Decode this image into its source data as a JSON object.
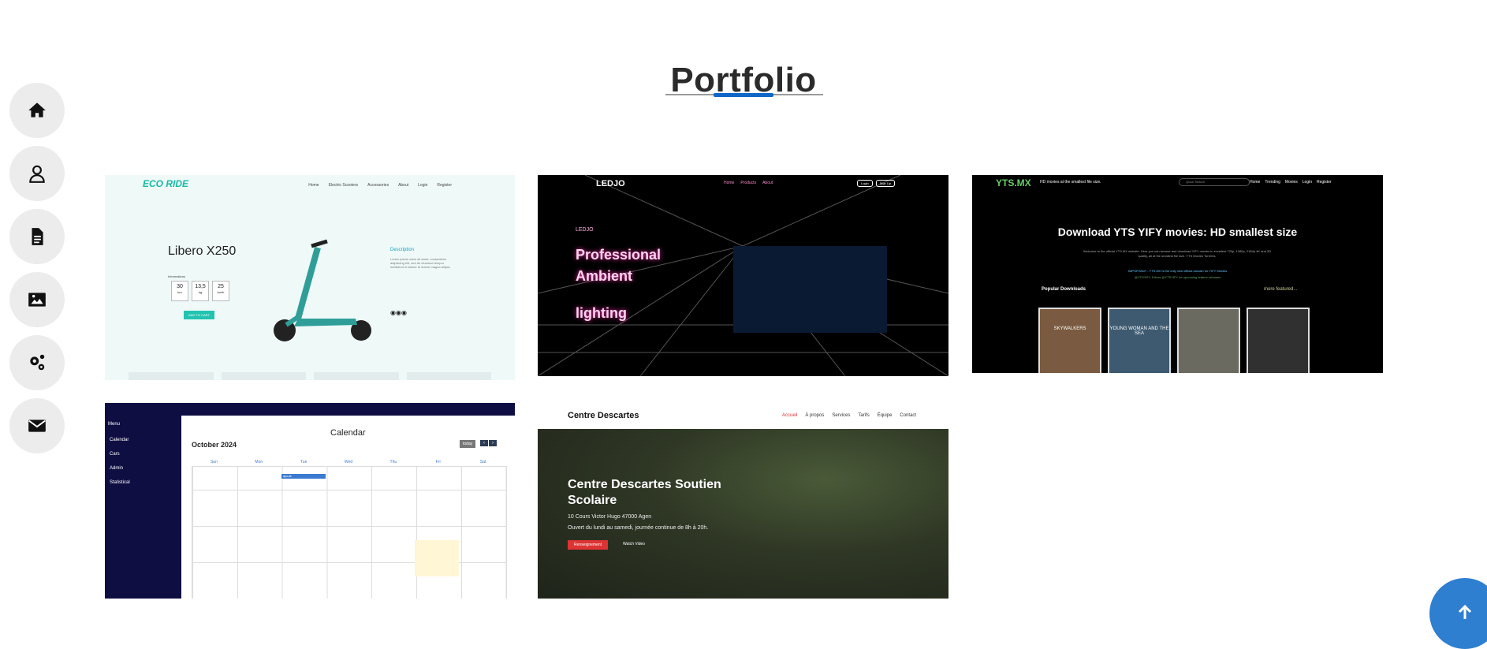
{
  "page": {
    "title": "Portfolio"
  },
  "sidebar": {
    "items": [
      {
        "icon": "home-icon"
      },
      {
        "icon": "user-icon"
      },
      {
        "icon": "document-icon"
      },
      {
        "icon": "image-icon"
      },
      {
        "icon": "gears-icon"
      },
      {
        "icon": "envelope-icon"
      }
    ]
  },
  "colors": {
    "accent": "#1167c8",
    "scroll_button": "#2f7fd0",
    "sidebar_bg": "#ececec"
  },
  "projects": {
    "ecoride": {
      "logo": "ECO RIDE",
      "nav": [
        "Home",
        "Electric Scooters",
        "Accessories",
        "About",
        "Login",
        "Register"
      ],
      "product": "Libero X250",
      "info_label": "Informations",
      "stats": [
        {
          "value": "30",
          "unit": "km"
        },
        {
          "value": "13,5",
          "unit": "kg"
        },
        {
          "value": "25",
          "unit": "km/h"
        }
      ],
      "button": "ADD TO CART",
      "description_title": "Description",
      "description_text": "Lorem ipsum dolor sit amet, consectetur adipiscing elit, sed do eiusmod tempor incididunt ut labore et dolore magna aliqua."
    },
    "ledjo": {
      "logo": "LEDJO",
      "nav": [
        "Home",
        "Products",
        "About"
      ],
      "auth": [
        "Login",
        "Sign Up"
      ],
      "brand": "LEDJO",
      "headline_1": "Professional",
      "headline_2": "Ambient",
      "headline_3": "lighting"
    },
    "yts": {
      "logo": "YTS.MX",
      "tagline": "HD movies at the smallest file size.",
      "search_placeholder": "Quick Search",
      "nav": [
        "Home",
        "Trending",
        "Movies",
        "Login",
        "Register"
      ],
      "heading": "Download YTS YIFY movies: HD smallest size",
      "subtext": "Welcome to the official YTS.MX website. Here you can browse and download YIFY movies in excellent 720p, 1080p, 2160p 4K and 3D quality, all at the smallest file size. YTS Movies Torrents.",
      "notice": "IMPORTANT - YTS.MX is the only new official domain for YIFY Movies",
      "follow": "@YTSYIFY Follow @YTSYIFY for upcoming feature releases",
      "popular": "Popular Downloads",
      "more": "more featured...",
      "posters": [
        "SKYWALKERS",
        "YOUNG WOMAN AND THE SEA",
        "",
        ""
      ]
    },
    "calendar": {
      "menu": "Menu",
      "menu_items": [
        "Calendar",
        "Cars",
        "Admin",
        "Statistical"
      ],
      "heading": "Calendar",
      "month": "October 2024",
      "today": "today",
      "days": [
        "Sun",
        "Mon",
        "Tue",
        "Wed",
        "Thu",
        "Fri",
        "Sat"
      ],
      "event": "ajouté"
    },
    "descartes": {
      "logo": "Centre Descartes",
      "nav": [
        "Accueil",
        "À propos",
        "Services",
        "Tarifs",
        "Équipe",
        "Contact"
      ],
      "headline": "Centre Descartes Soutien Scolaire",
      "address": "10 Cours Victor Hugo 47000 Agen",
      "hours": "Ouvert du lundi au samedi, journée continue de 8h à 20h.",
      "cta": "Renseignement",
      "watch": "Watch Video"
    }
  }
}
